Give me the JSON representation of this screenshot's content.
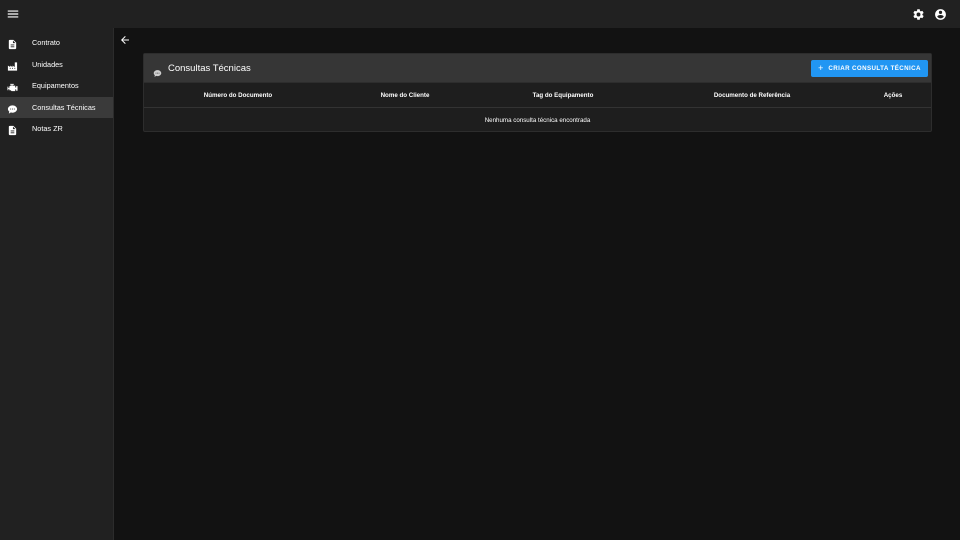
{
  "topbar": {
    "menu_icon": "menu-icon",
    "settings_icon": "gear-icon",
    "account_icon": "account-circle-icon"
  },
  "sidebar": {
    "items": [
      {
        "label": "Contrato",
        "icon": "document-icon",
        "active": false
      },
      {
        "label": "Unidades",
        "icon": "factory-icon",
        "active": false
      },
      {
        "label": "Equipamentos",
        "icon": "engine-icon",
        "active": false
      },
      {
        "label": "Consultas Técnicas",
        "icon": "chat-bubble-icon",
        "active": true
      },
      {
        "label": "Notas ZR",
        "icon": "document-icon",
        "active": false
      }
    ]
  },
  "back_icon": "arrow-left-icon",
  "main": {
    "title": "Consultas Técnicas",
    "title_icon": "chat-bubble-icon",
    "create_button": {
      "plus": "+",
      "label": "CRIAR CONSULTA TÉCNICA"
    },
    "table": {
      "columns": [
        "Número do Documento",
        "Nome do Cliente",
        "Tag do Equipamento",
        "Documento de Referência",
        "Ações"
      ],
      "empty_message": "Nenhuma consulta técnica encontrada"
    }
  },
  "colors": {
    "background": "#121212",
    "surface": "#212121",
    "accent": "#2196f3",
    "active_nav": "#3a3a3a"
  }
}
